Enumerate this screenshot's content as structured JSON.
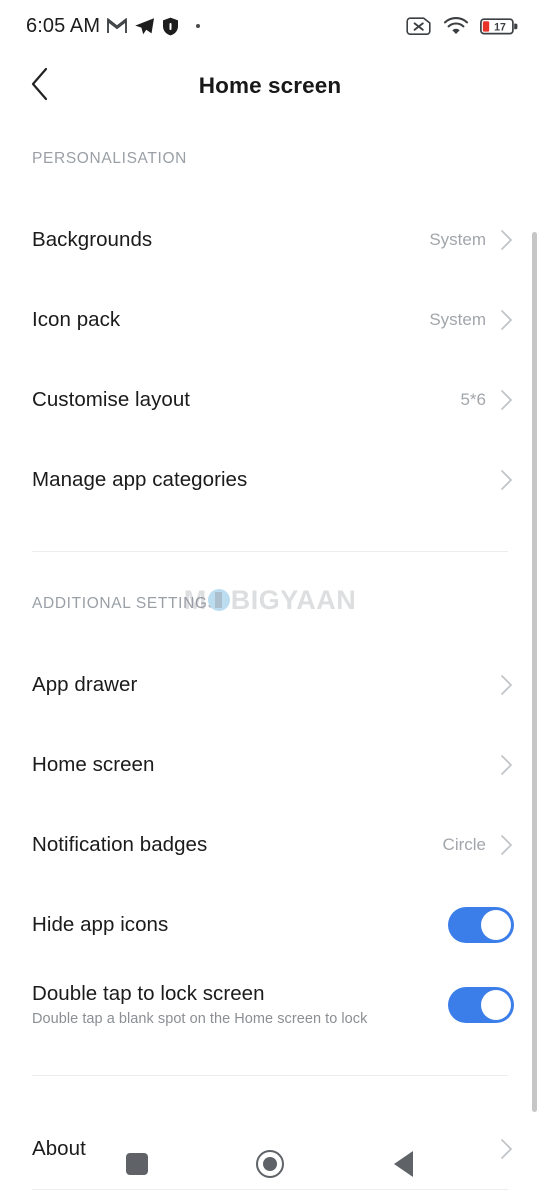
{
  "statusbar": {
    "time": "6:05 AM",
    "left_icons": [
      "gmail-icon",
      "telegram-icon",
      "shield-icon",
      "more-dot-icon"
    ],
    "right_icons": [
      "no-sim-icon",
      "wifi-icon",
      "battery-icon"
    ],
    "battery_level": "17",
    "battery_color": "#e8332a"
  },
  "header": {
    "back_icon": "chevron-left-icon",
    "title": "Home screen"
  },
  "sections": [
    {
      "label": "PERSONALISATION",
      "rows": [
        {
          "title": "Backgrounds",
          "value": "System",
          "type": "link"
        },
        {
          "title": "Icon pack",
          "value": "System",
          "type": "link"
        },
        {
          "title": "Customise layout",
          "value": "5*6",
          "type": "link"
        },
        {
          "title": "Manage app categories",
          "value": "",
          "type": "link"
        }
      ]
    },
    {
      "label": "ADDITIONAL SETTINGS",
      "rows": [
        {
          "title": "App drawer",
          "value": "",
          "type": "link"
        },
        {
          "title": "Home screen",
          "value": "",
          "type": "link"
        },
        {
          "title": "Notification badges",
          "value": "Circle",
          "type": "link"
        },
        {
          "title": "Hide app icons",
          "value": "",
          "type": "toggle",
          "toggle_on": true
        },
        {
          "title": "Double tap to lock screen",
          "subtitle": "Double tap a blank spot on the Home screen to lock",
          "value": "",
          "type": "toggle",
          "toggle_on": true
        }
      ]
    },
    {
      "label": "",
      "rows": [
        {
          "title": "About",
          "value": "",
          "type": "link"
        }
      ]
    }
  ],
  "watermark": {
    "before": "M",
    "after": "BIGYAAN"
  },
  "navbar": {
    "recents_label": "recents",
    "home_label": "home",
    "back_label": "back"
  },
  "colors": {
    "toggle_on": "#3b7eea",
    "accent_blue": "#3b7eea",
    "text_primary": "#1b1b1b",
    "text_secondary": "#9aa0a6"
  }
}
